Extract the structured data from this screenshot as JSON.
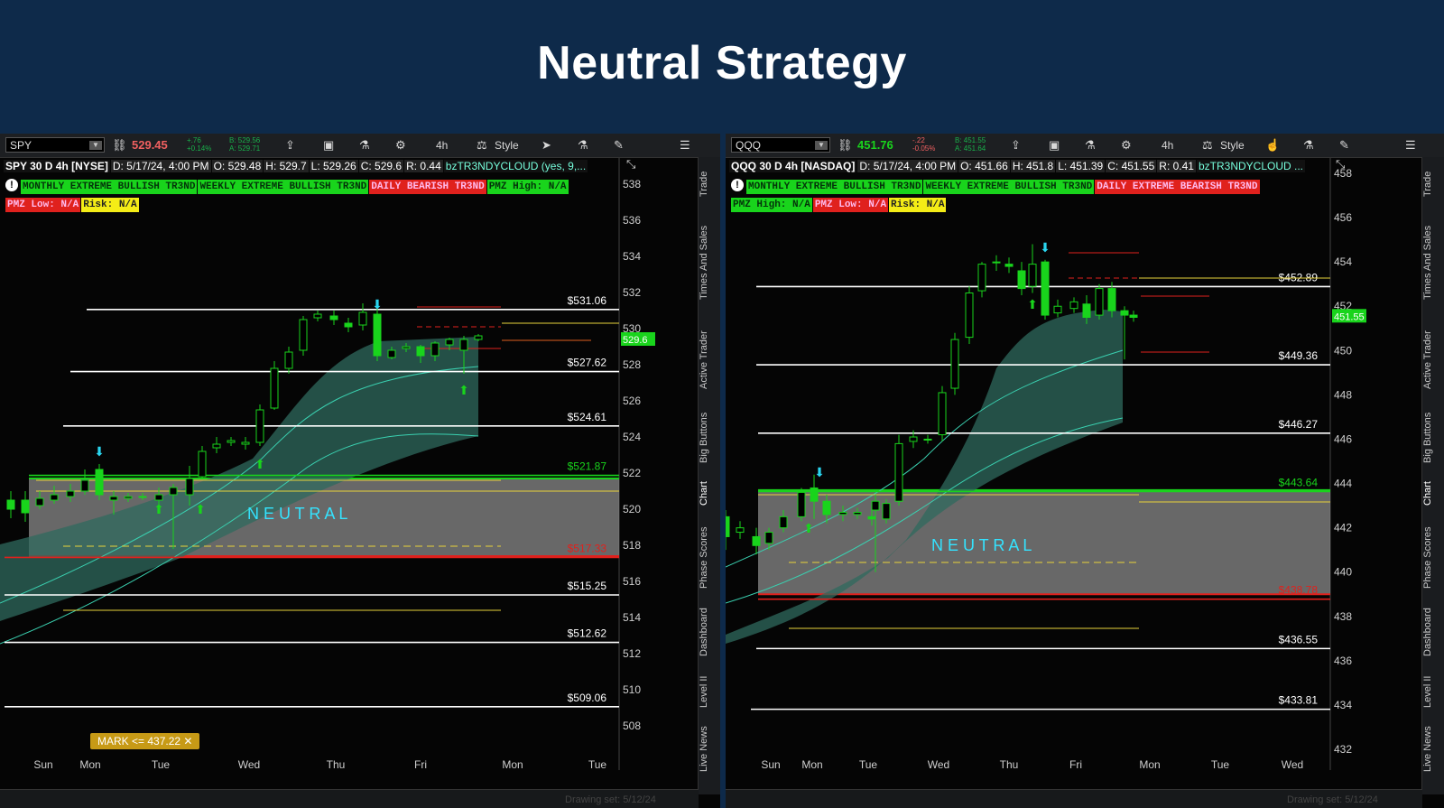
{
  "page_title": "Neutral Strategy",
  "colors": {
    "bg": "#0e2a4a",
    "bull": "#19d41c",
    "bear": "#e0211d",
    "cloud": "#2f6a5e"
  },
  "charts": {
    "spy": {
      "symbol": "SPY",
      "last": "529.45",
      "change": "+.76",
      "change_pct": "+0.14%",
      "bid": "B: 529.56",
      "ask": "A: 529.71",
      "info": {
        "sym": "SPY 30 D 4h [NYSE]",
        "d": "D: 5/17/24, 4:00 PM",
        "o": "O: 529.48",
        "h": "H: 529.7",
        "l": "L: 529.26",
        "c": "C: 529.6",
        "r": "R: 0.44",
        "study": "bzTR3NDYCLOUD (yes, 9,..."
      },
      "labels": [
        {
          "text": "MONTHLY EXTREME BULLISH TR3ND",
          "color": "green"
        },
        {
          "text": "WEEKLY EXTREME BULLISH TR3ND",
          "color": "green"
        },
        {
          "text": "DAILY BEARISH TR3ND",
          "color": "red"
        },
        {
          "text": "PMZ High: N/A",
          "color": "green"
        },
        {
          "text": "PMZ Low: N/A",
          "color": "red"
        },
        {
          "text": "Risk: N/A",
          "color": "yellow"
        }
      ],
      "price_ticks": [
        "538",
        "536",
        "534",
        "532",
        "530",
        "528",
        "526",
        "524",
        "522",
        "520",
        "518",
        "516",
        "514",
        "512",
        "510",
        "508"
      ],
      "price_tag": "529.6",
      "level_labels": {
        "l531": "$531.06",
        "l527": "$527.62",
        "l524": "$524.61",
        "l521": "$521.87",
        "l517": "$517.33",
        "l515": "$515.25",
        "l512": "$512.62",
        "l509": "$509.06"
      },
      "neutral_label": "NEUTRAL",
      "x_ticks": [
        "Sun",
        "Mon",
        "Tue",
        "Wed",
        "Thu",
        "Fri",
        "Mon",
        "Tue"
      ],
      "mark_tag": "MARK <= 437.22",
      "drawing_set": "Drawing set: 5/12/24"
    },
    "qqq": {
      "symbol": "QQQ",
      "last": "451.76",
      "change": "-.22",
      "change_pct": "-0.05%",
      "bid": "B: 451.55",
      "ask": "A: 451.64",
      "info": {
        "sym": "QQQ 30 D 4h [NASDAQ]",
        "d": "D: 5/17/24, 4:00 PM",
        "o": "O: 451.66",
        "h": "H: 451.8",
        "l": "L: 451.39",
        "c": "C: 451.55",
        "r": "R: 0.41",
        "study": "bzTR3NDYCLOUD ..."
      },
      "labels": [
        {
          "text": "MONTHLY EXTREME BULLISH TR3ND",
          "color": "green"
        },
        {
          "text": "WEEKLY EXTREME BULLISH TR3ND",
          "color": "green"
        },
        {
          "text": "DAILY EXTREME BEARISH TR3ND",
          "color": "red"
        },
        {
          "text": "PMZ High: N/A",
          "color": "green"
        },
        {
          "text": "PMZ Low: N/A",
          "color": "red"
        },
        {
          "text": "Risk: N/A",
          "color": "yellow"
        }
      ],
      "price_ticks": [
        "458",
        "456",
        "454",
        "452",
        "450",
        "448",
        "446",
        "444",
        "442",
        "440",
        "438",
        "436",
        "434",
        "432"
      ],
      "price_tag": "451.55",
      "level_labels": {
        "l452": "$452.89",
        "l449": "$449.36",
        "l446": "$446.27",
        "l443": "$443.64",
        "l438": "$438.78",
        "l436": "$436.55",
        "l433": "$433.81"
      },
      "neutral_label": "NEUTRAL",
      "x_ticks": [
        "Sun",
        "Mon",
        "Tue",
        "Wed",
        "Thu",
        "Fri",
        "Mon",
        "Tue",
        "Wed"
      ],
      "drawing_set": "Drawing set: 5/12/24"
    }
  },
  "toolbar": {
    "interval": "4h",
    "style": "Style"
  },
  "side_tabs": [
    "Trade",
    "Times And Sales",
    "Active Trader",
    "Big Buttons",
    "Chart",
    "Phase Scores",
    "Dashboard",
    "Level II",
    "Live News"
  ]
}
